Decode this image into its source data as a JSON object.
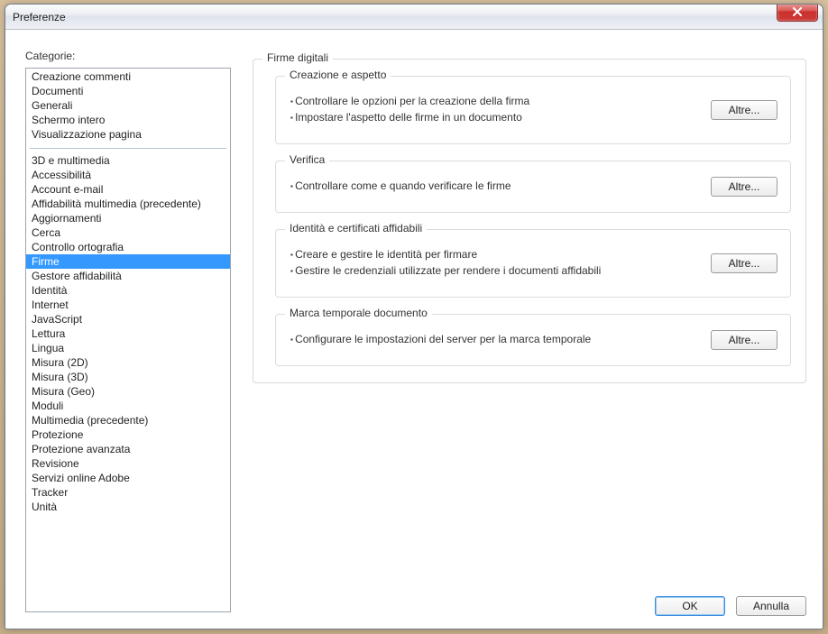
{
  "window": {
    "title": "Preferenze"
  },
  "categoriesLabel": "Categorie:",
  "categories": {
    "group1": [
      "Creazione commenti",
      "Documenti",
      "Generali",
      "Schermo intero",
      "Visualizzazione pagina"
    ],
    "group2": [
      "3D e multimedia",
      "Accessibilità",
      "Account e-mail",
      "Affidabilità multimedia (precedente)",
      "Aggiornamenti",
      "Cerca",
      "Controllo ortografia",
      "Firme",
      "Gestore affidabilità",
      "Identità",
      "Internet",
      "JavaScript",
      "Lettura",
      "Lingua",
      "Misura (2D)",
      "Misura (3D)",
      "Misura (Geo)",
      "Moduli",
      "Multimedia (precedente)",
      "Protezione",
      "Protezione avanzata",
      "Revisione",
      "Servizi online Adobe",
      "Tracker",
      "Unità"
    ],
    "selected": "Firme"
  },
  "panel": {
    "title": "Firme digitali",
    "sections": [
      {
        "title": "Creazione e aspetto",
        "bullets": [
          "Controllare le opzioni per la creazione della firma",
          "Impostare l'aspetto delle firme in un documento"
        ],
        "button": "Altre..."
      },
      {
        "title": "Verifica",
        "bullets": [
          "Controllare come e quando verificare le firme"
        ],
        "button": "Altre..."
      },
      {
        "title": "Identità e certificati affidabili",
        "bullets": [
          "Creare e gestire le identità per firmare",
          "Gestire le credenziali utilizzate per rendere i documenti affidabili"
        ],
        "button": "Altre..."
      },
      {
        "title": "Marca temporale documento",
        "bullets": [
          "Configurare le impostazioni del server per la marca temporale"
        ],
        "button": "Altre..."
      }
    ]
  },
  "footer": {
    "ok": "OK",
    "cancel": "Annulla"
  }
}
